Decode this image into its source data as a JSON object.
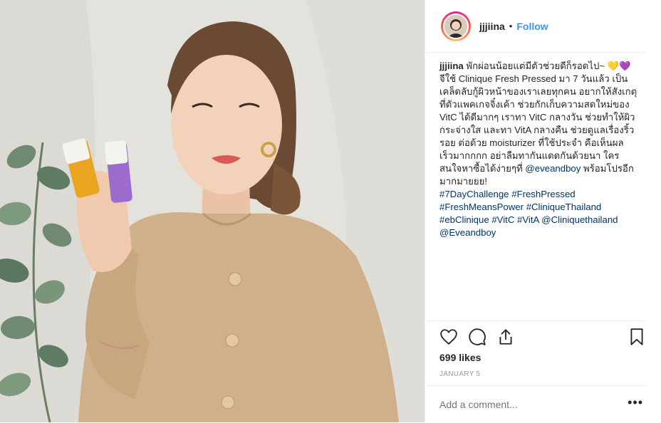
{
  "header": {
    "username": "jjjiina",
    "separator": "•",
    "follow_label": "Follow"
  },
  "caption": {
    "username": "jjjiina",
    "lines": [
      "พักผ่อนน้อยแต่มีตัวช่วยดีก็รอดไป~ 💛💜",
      "จีใช้ Clinique Fresh Pressed มา 7 วันแล้ว เป็น",
      "เคล็ดลับกู้ผิวหน้าของเราเลยทุกคน อยากให้สังเกตุ",
      "ที่ตัวแพคเกจจิ๋งเค้า ช่วยกักเก็บความสดใหม่ของ",
      "VitC ได้ดีมากๆ เราทา VitC กลางวัน ช่วยทำให้ผิว",
      "กระจ่างใส และทา VitA กลางคืน ช่วยดูแลเรื่องริ้ว",
      "รอย ต่อด้วย moisturizer ที่ใช้ประจำ คือเห็นผล",
      "เร็วมากกกก อย่าลืมทากันแดดกันด้วยนา ใคร",
      "สนใจหาซื้อได้ง่ายๆที่"
    ],
    "mention_inline": "@eveandboy",
    "after_mention": " พร้อมโปรอีก",
    "last_text": "มากมายยย!",
    "hashtag_lines": [
      [
        "#7DayChallenge",
        "#FreshPressed"
      ],
      [
        "#FreshMeansPower",
        "#CliniqueThailand"
      ],
      [
        "#ebClinique",
        "#VitC",
        "#VitA",
        "@Cliniquethailand"
      ],
      [
        "@Eveandboy"
      ]
    ]
  },
  "actions": {
    "icons": [
      "heart-icon",
      "comment-icon",
      "share-icon",
      "bookmark-icon"
    ]
  },
  "likes_label": "699 likes",
  "date_label": "JANUARY 5",
  "comment": {
    "placeholder": "Add a comment...",
    "more_label": "•••"
  },
  "colors": {
    "link": "#3897f0",
    "hashtag": "#003569",
    "text": "#262626",
    "muted": "#999999",
    "divider": "#efefef"
  }
}
